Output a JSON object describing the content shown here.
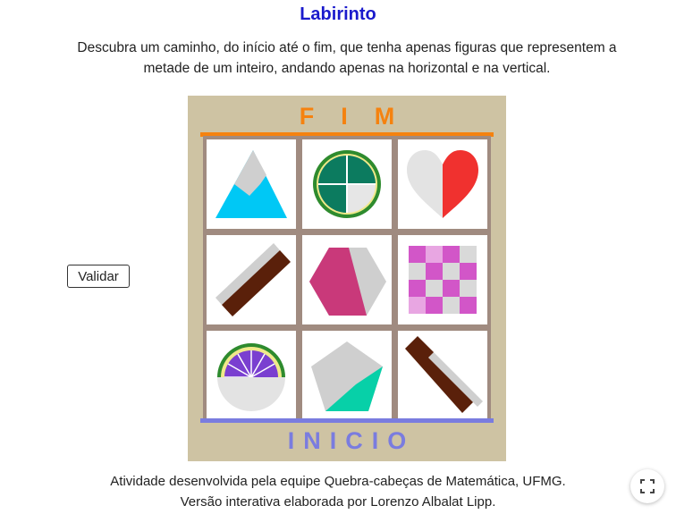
{
  "title": "Labirinto",
  "instructions": "Descubra um caminho, do início até o fim, que tenha apenas figuras que representem a metade de um inteiro, andando apenas na horizontal e na vertical.",
  "validate_button": "Validar",
  "board": {
    "end_label": "FIM",
    "start_label": "INICIO",
    "cells": [
      {
        "figure": "triangle-icon"
      },
      {
        "figure": "circle-quarters-icon"
      },
      {
        "figure": "heart-icon"
      },
      {
        "figure": "bar-diagonal-icon"
      },
      {
        "figure": "hexagon-icon"
      },
      {
        "figure": "checkerboard-icon"
      },
      {
        "figure": "semicircle-sectors-icon"
      },
      {
        "figure": "pentagon-icon"
      },
      {
        "figure": "bar-bent-icon"
      }
    ]
  },
  "colors": {
    "title": "#1a1acc",
    "end": "#f5820f",
    "start": "#7a7cdf",
    "board": "#cec3a3",
    "grid_lines": "#a08b80"
  },
  "footer": {
    "line1": "Atividade desenvolvida pela equipe Quebra-cabeças de Matemática, UFMG.",
    "line2": "Versão interativa elaborada por Lorenzo Albalat Lipp."
  }
}
